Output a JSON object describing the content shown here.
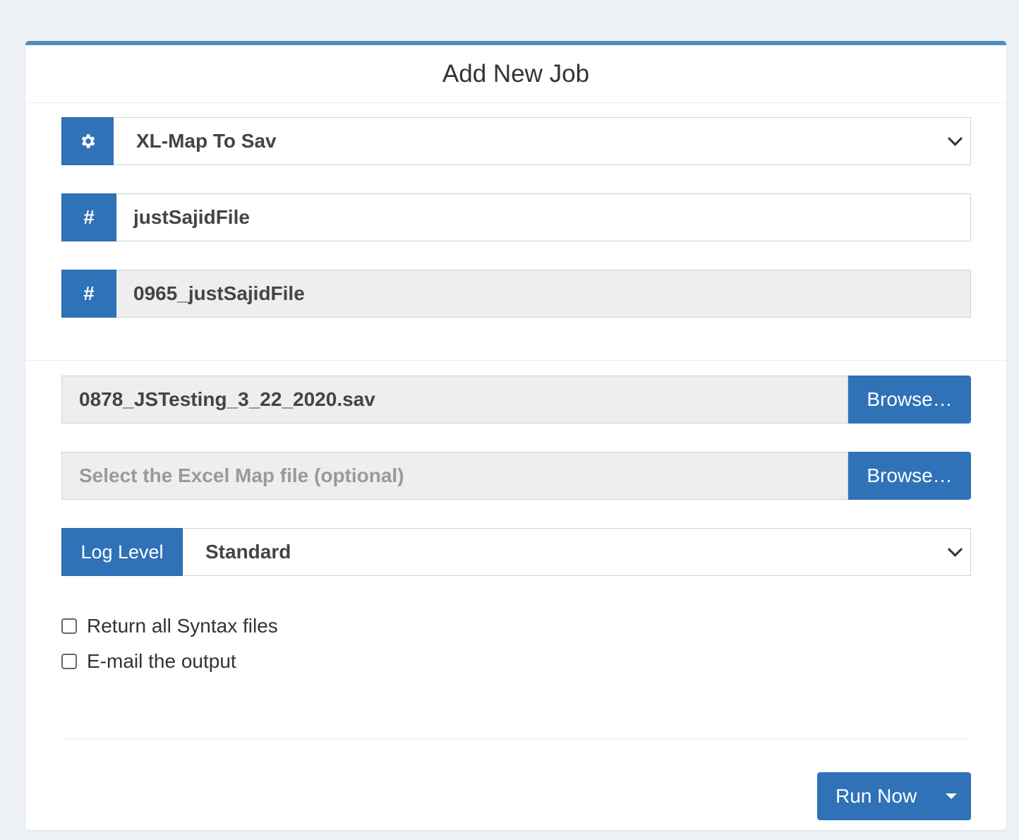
{
  "panel": {
    "title": "Add New Job"
  },
  "job_type": {
    "icon": "gear-icon",
    "value": "XL-Map To Sav"
  },
  "job_name": {
    "icon": "hash-icon",
    "symbol": "#",
    "value": "justSajidFile"
  },
  "job_id": {
    "icon": "hash-icon",
    "symbol": "#",
    "value": "0965_justSajidFile"
  },
  "data_file": {
    "value": "0878_JSTesting_3_22_2020.sav",
    "browse_label": "Browse…"
  },
  "map_file": {
    "placeholder": "Select the Excel Map file (optional)",
    "browse_label": "Browse…"
  },
  "log_level": {
    "label": "Log Level",
    "value": "Standard"
  },
  "options": {
    "return_syntax": {
      "label": "Return all Syntax files",
      "checked": false
    },
    "email_output": {
      "label": "E-mail the output",
      "checked": false
    }
  },
  "run": {
    "label": "Run Now"
  },
  "colors": {
    "accent": "#2f72b8",
    "panel_border": "#4a8ec2",
    "background": "#edf0f4"
  }
}
